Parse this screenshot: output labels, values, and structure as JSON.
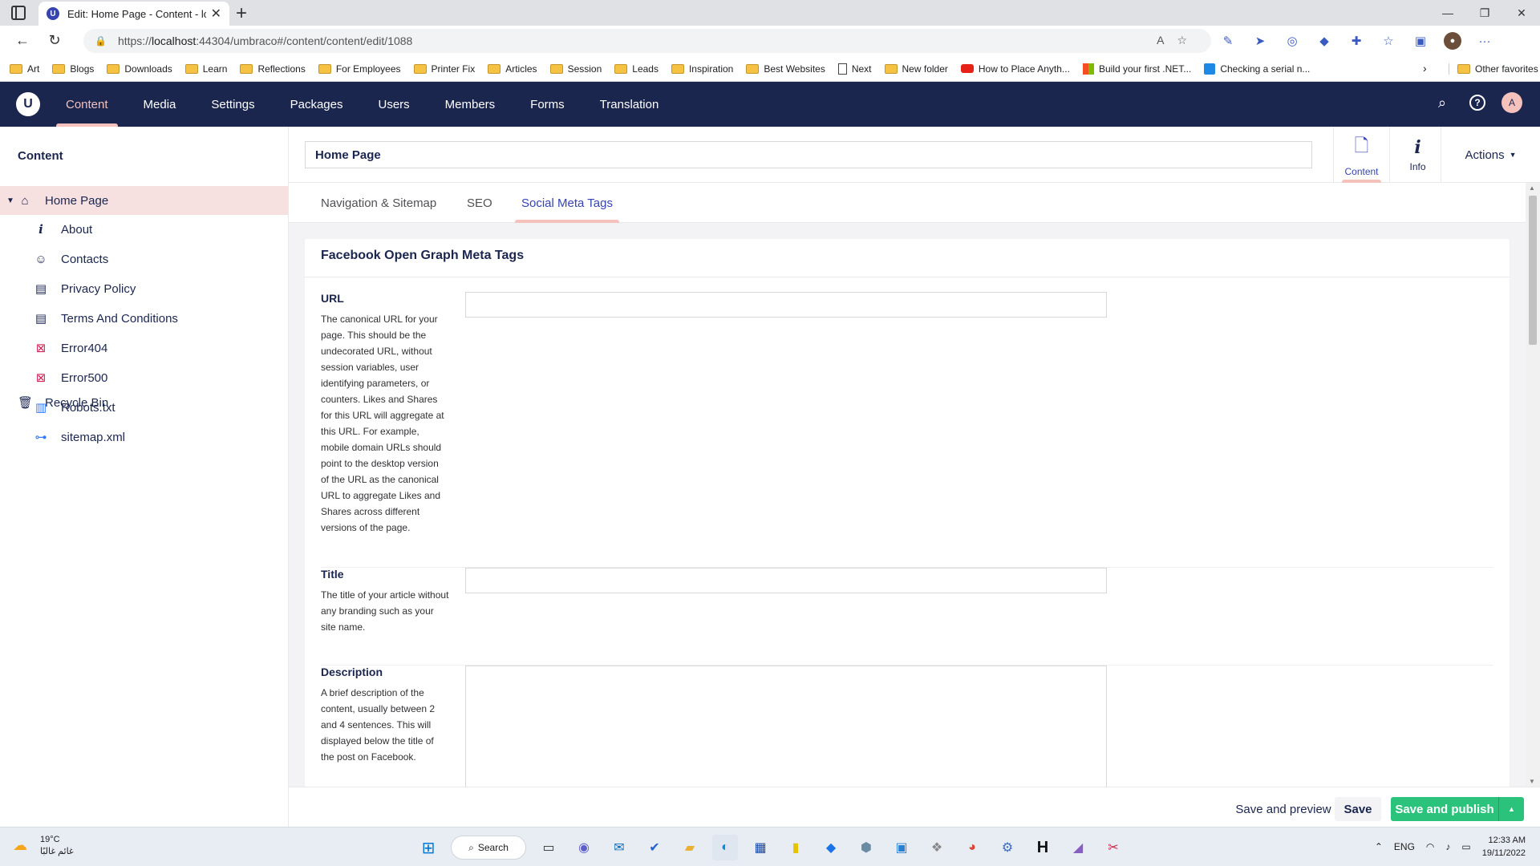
{
  "browser": {
    "tab_title": "Edit: Home Page - Content - loca",
    "url_prefix": "https://",
    "url_host": "localhost",
    "url_rest": ":44304/umbraco#/content/content/edit/1088",
    "bookmarks": [
      {
        "label": "Art",
        "icon": "folder"
      },
      {
        "label": "Blogs",
        "icon": "folder"
      },
      {
        "label": "Downloads",
        "icon": "folder"
      },
      {
        "label": "Learn",
        "icon": "folder"
      },
      {
        "label": "Reflections",
        "icon": "folder"
      },
      {
        "label": "For Employees",
        "icon": "folder"
      },
      {
        "label": "Printer Fix",
        "icon": "folder"
      },
      {
        "label": "Articles",
        "icon": "folder"
      },
      {
        "label": "Session",
        "icon": "folder"
      },
      {
        "label": "Leads",
        "icon": "folder"
      },
      {
        "label": "Inspiration",
        "icon": "folder"
      },
      {
        "label": "Best Websites",
        "icon": "folder"
      },
      {
        "label": "Next",
        "icon": "file"
      },
      {
        "label": "New folder",
        "icon": "folder"
      },
      {
        "label": "How to Place Anyth...",
        "icon": "youtube"
      },
      {
        "label": "Build your first .NET...",
        "icon": "microsoft"
      },
      {
        "label": "Checking a serial n...",
        "icon": "page"
      }
    ],
    "other_favorites": "Other favorites"
  },
  "header": {
    "sections": [
      "Content",
      "Media",
      "Settings",
      "Packages",
      "Users",
      "Members",
      "Forms",
      "Translation"
    ],
    "active_section": "Content",
    "avatar_initial": "A"
  },
  "tree": {
    "title": "Content",
    "root": {
      "label": "Home Page",
      "icon": "home-icon"
    },
    "children": [
      {
        "label": "About",
        "icon": "info-icon"
      },
      {
        "label": "Contacts",
        "icon": "contact-icon"
      },
      {
        "label": "Privacy Policy",
        "icon": "document-icon"
      },
      {
        "label": "Terms And Conditions",
        "icon": "document-icon"
      },
      {
        "label": "Error404",
        "icon": "error-icon"
      },
      {
        "label": "Error500",
        "icon": "error-icon"
      },
      {
        "label": "Robots.txt",
        "icon": "text-file-icon"
      },
      {
        "label": "sitemap.xml",
        "icon": "sitemap-icon"
      }
    ],
    "recycle_bin": {
      "label": "Recycle Bin",
      "icon": "trash-icon"
    }
  },
  "editor": {
    "name_value": "Home Page",
    "apps": [
      {
        "label": "Content",
        "icon": "document-icon",
        "active": true
      },
      {
        "label": "Info",
        "icon": "info-icon",
        "active": false
      }
    ],
    "actions_label": "Actions",
    "tabs": [
      "Navigation & Sitemap",
      "SEO",
      "Social Meta Tags"
    ],
    "active_tab": "Social Meta Tags",
    "group_title": "Facebook Open Graph Meta Tags",
    "properties": [
      {
        "label": "URL",
        "description": "The canonical URL for your page. This should be the undecorated URL, without session variables, user identifying parameters, or counters. Likes and Shares for this URL will aggregate at this URL. For example, mobile domain URLs should point to the desktop version of the URL as the canonical URL to aggregate Likes and Shares across different versions of the page.",
        "value": ""
      },
      {
        "label": "Title",
        "description": "The title of your article without any branding such as your site name.",
        "value": ""
      },
      {
        "label": "Description",
        "description": "A brief description of the content, usually between 2 and 4 sentences. This will displayed below the title of the post on Facebook.",
        "value": ""
      }
    ]
  },
  "footer": {
    "save_preview": "Save and preview",
    "save": "Save",
    "save_publish": "Save and publish"
  },
  "taskbar": {
    "weather_temp": "19°C",
    "weather_desc": "غائم غالبًا",
    "search_label": "Search",
    "language": "ENG",
    "time": "12:33 AM",
    "date": "19/11/2022"
  },
  "colors": {
    "header_bg": "#1b264f",
    "accent_pink": "#f5c1bc",
    "publish_green": "#2bc37c",
    "active_blue": "#3544b1"
  }
}
